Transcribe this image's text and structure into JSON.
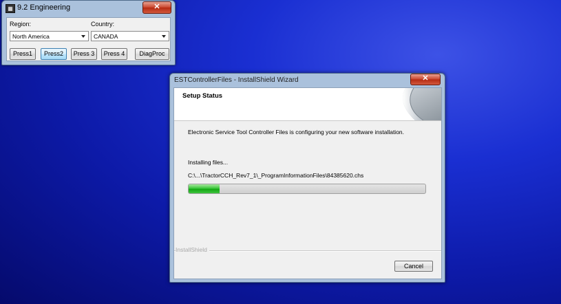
{
  "engineering_window": {
    "title": "9.2  Engineering",
    "icon": "app-icon",
    "close_label": "✕",
    "region_label": "Region:",
    "region_value": "North America",
    "country_label": "Country:",
    "country_value": "CANADA",
    "buttons": [
      "Press1",
      "Press2",
      "Press 3",
      "Press 4",
      "DiagProc"
    ],
    "active_button": "Press2"
  },
  "wizard": {
    "title": "ESTControllerFiles - InstallShield Wizard",
    "close_label": "✕",
    "header_title": "Setup Status",
    "description": "Electronic Service Tool Controller Files is configuring your new software installation.",
    "status": "Installing files...",
    "current_file": "C:\\...\\TractorCCH_Rev7_1\\_ProgramInformationFiles\\84385620.chs",
    "progress_percent": 13,
    "brand_label": "InstallShield",
    "cancel_label": "Cancel"
  },
  "colors": {
    "progress_fill": "#22b322",
    "desktop_blue": "#1a2fd2",
    "close_red": "#c9442c"
  }
}
